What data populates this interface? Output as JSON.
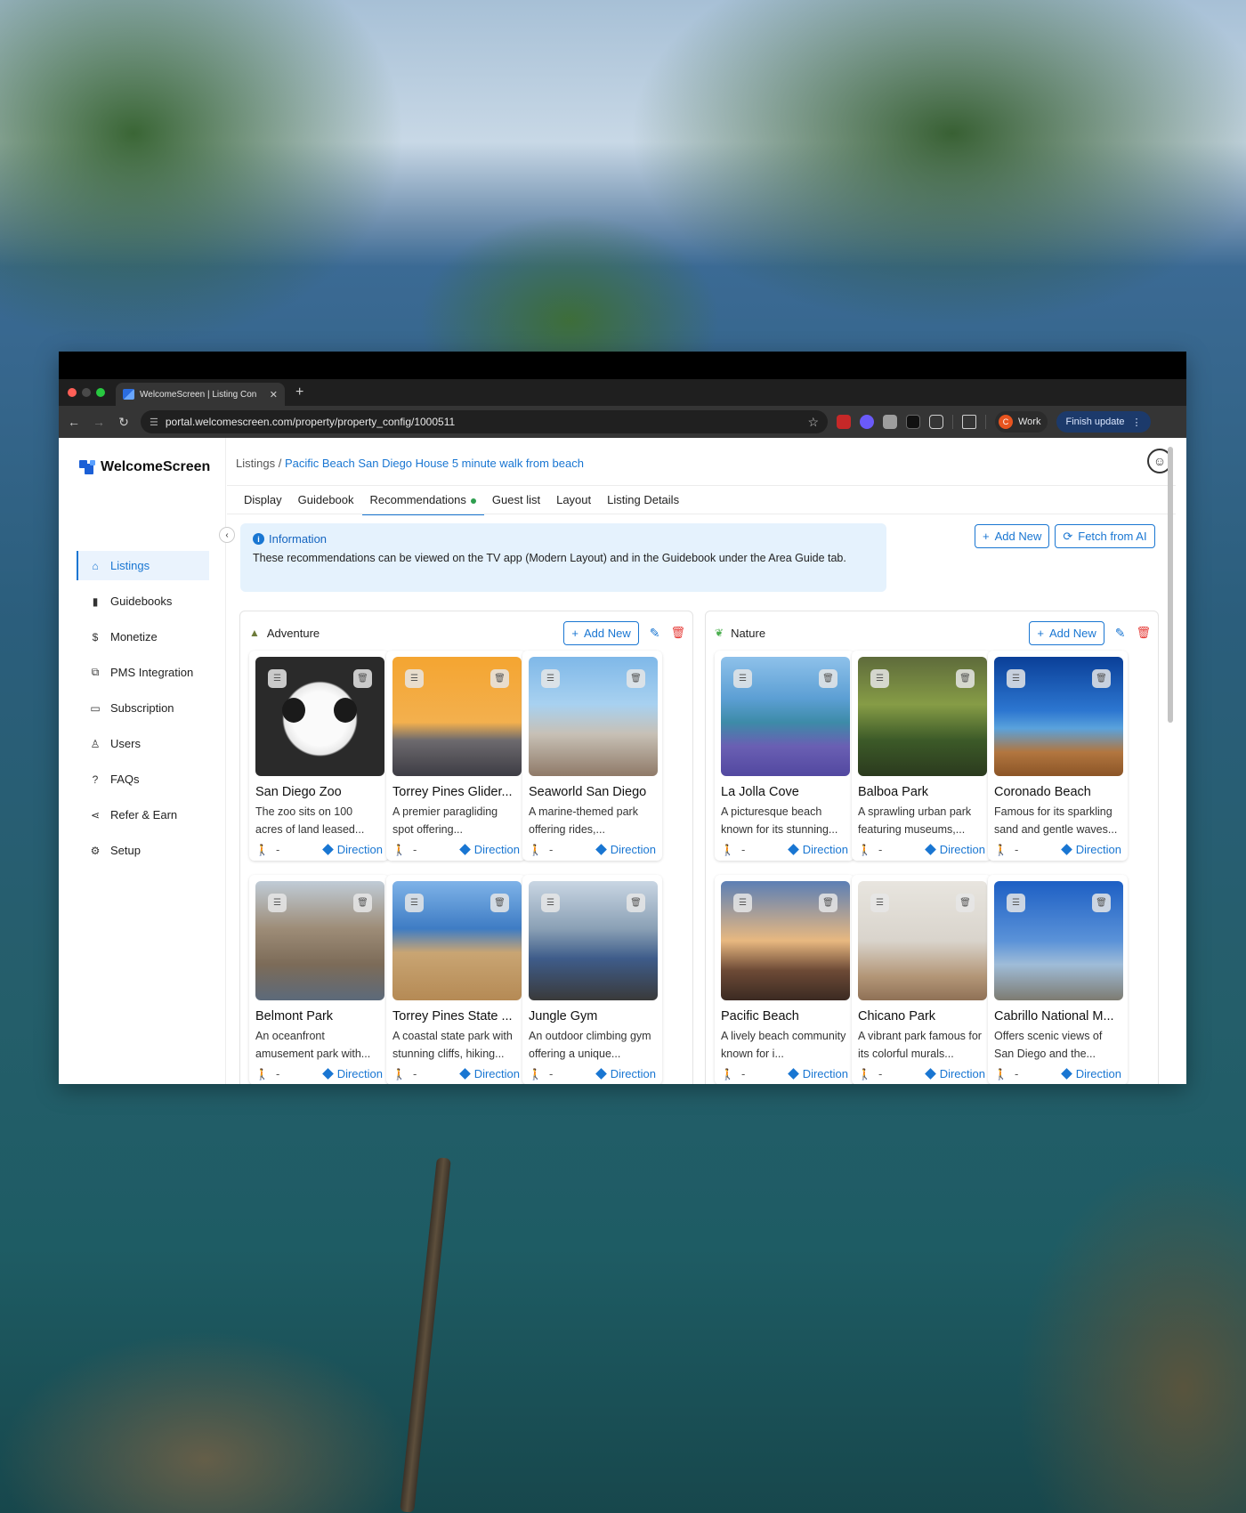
{
  "browser": {
    "tab_title": "WelcomeScreen | Listing Con",
    "url": "portal.welcomescreen.com/property/property_config/1000511",
    "profile_initial": "C",
    "profile_label": "Work",
    "update_label": "Finish update"
  },
  "app": {
    "logo_text": "WelcomeScreen",
    "sidebar": [
      {
        "label": "Listings",
        "icon": "house-icon",
        "glyph": "⌂"
      },
      {
        "label": "Guidebooks",
        "icon": "book-icon",
        "glyph": "▮"
      },
      {
        "label": "Monetize",
        "icon": "dollar-icon",
        "glyph": "$"
      },
      {
        "label": "PMS Integration",
        "icon": "puzzle-icon",
        "glyph": "⧉"
      },
      {
        "label": "Subscription",
        "icon": "briefcase-icon",
        "glyph": "▭"
      },
      {
        "label": "Users",
        "icon": "user-icon",
        "glyph": "♙"
      },
      {
        "label": "FAQs",
        "icon": "question-icon",
        "glyph": "?"
      },
      {
        "label": "Refer & Earn",
        "icon": "share-icon",
        "glyph": "⋖"
      },
      {
        "label": "Setup",
        "icon": "gear-icon",
        "glyph": "⚙"
      }
    ],
    "breadcrumb": {
      "root": "Listings",
      "sep": "/",
      "current": "Pacific Beach San Diego House 5 minute walk from beach"
    },
    "tabs": [
      "Display",
      "Guidebook",
      "Recommendations",
      "Guest list",
      "Layout",
      "Listing Details"
    ],
    "info": {
      "title": "Information",
      "text": "These recommendations can be viewed on the TV app (Modern Layout) and in the Guidebook under the Area Guide tab."
    },
    "actions": {
      "add_new": "Add New",
      "fetch_ai": "Fetch from AI"
    },
    "direction_label": "Direction",
    "walk_value": "-",
    "categories": [
      {
        "title": "Adventure",
        "icon": "mountain-icon",
        "add_label": "Add New",
        "cards": [
          {
            "name": "San Diego Zoo",
            "desc": "The zoo sits on 100 acres of land leased...",
            "img": "i-panda"
          },
          {
            "name": "Torrey Pines Glider...",
            "desc": "A premier paragliding spot offering...",
            "img": "i-glider"
          },
          {
            "name": "Seaworld San Diego",
            "desc": "A marine-themed park offering rides,...",
            "img": "i-sea"
          },
          {
            "name": "Belmont Park",
            "desc": "An oceanfront amusement park with...",
            "img": "i-belmont"
          },
          {
            "name": "Torrey Pines State ...",
            "desc": "A coastal state park with stunning cliffs, hiking...",
            "img": "i-torreystate"
          },
          {
            "name": "Jungle Gym",
            "desc": "An outdoor climbing gym offering a unique...",
            "img": "i-jungle"
          }
        ]
      },
      {
        "title": "Nature",
        "icon": "leaf-icon",
        "add_label": "Add New",
        "cards": [
          {
            "name": "La Jolla Cove",
            "desc": "A picturesque beach known for its stunning...",
            "img": "i-cove"
          },
          {
            "name": "Balboa Park",
            "desc": "A sprawling urban park featuring museums,...",
            "img": "i-balboa"
          },
          {
            "name": "Coronado Beach",
            "desc": "Famous for its sparkling sand and gentle waves...",
            "img": "i-coronado"
          },
          {
            "name": "Pacific Beach",
            "desc": "A lively beach community known for i...",
            "img": "i-pacific"
          },
          {
            "name": "Chicano Park",
            "desc": "A vibrant park famous for its colorful murals...",
            "img": "i-chicano"
          },
          {
            "name": "Cabrillo National M...",
            "desc": "Offers scenic views of San Diego and the...",
            "img": "i-cabrillo"
          }
        ]
      }
    ]
  },
  "colors": {
    "accent": "#1976d2",
    "danger": "#e53935",
    "info_bg": "#e5f2fd"
  }
}
